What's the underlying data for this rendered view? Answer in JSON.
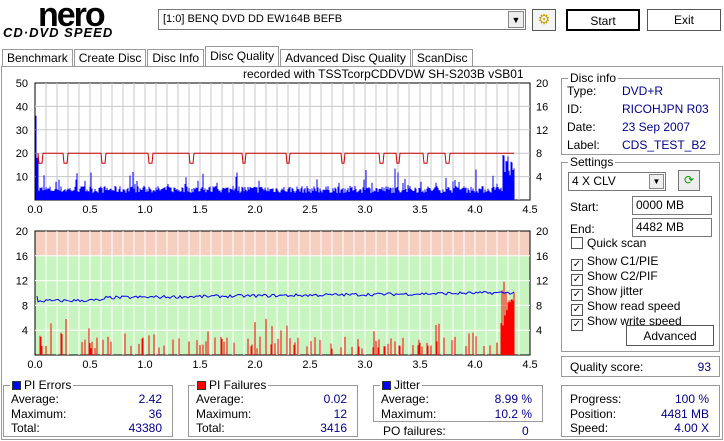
{
  "app": {
    "logo_top": "nero",
    "logo_bottom": "CD·DVD SPEED"
  },
  "toolbar": {
    "drive": "[1:0]  BENQ DVD DD EW164B BEFB",
    "start": "Start",
    "exit": "Exit"
  },
  "tabs": [
    "Benchmark",
    "Create Disc",
    "Disc Info",
    "Disc Quality",
    "Advanced Disc Quality",
    "ScanDisc"
  ],
  "recorded_with": "recorded with TSSTcorpCDDVDW SH-S203B  vSB01",
  "disc_info": {
    "title": "Disc info",
    "type_label": "Type:",
    "type": "DVD+R",
    "id_label": "ID:",
    "id": "RICOHJPN R03",
    "date_label": "Date:",
    "date": "23 Sep 2007",
    "label_label": "Label:",
    "label": "CDS_TEST_B2"
  },
  "settings": {
    "title": "Settings",
    "speed": "4 X CLV",
    "start_label": "Start:",
    "start": "0000 MB",
    "end_label": "End:",
    "end": "4482 MB",
    "quick_scan": "Quick scan",
    "show_c1": "Show C1/PIE",
    "show_c2": "Show C2/PIF",
    "show_jitter": "Show jitter",
    "show_read": "Show read speed",
    "show_write": "Show write speed",
    "advanced": "Advanced",
    "checks": [
      false,
      true,
      true,
      true,
      true,
      true
    ]
  },
  "quality": {
    "label": "Quality score:",
    "value": "93"
  },
  "pi_errors": {
    "title": "PI Errors",
    "avg_label": "Average:",
    "avg": "2.42",
    "max_label": "Maximum:",
    "max": "36",
    "total_label": "Total:",
    "total": "43380",
    "color": "#0000ff"
  },
  "pi_failures": {
    "title": "PI Failures",
    "avg_label": "Average:",
    "avg": "0.02",
    "max_label": "Maximum:",
    "max": "12",
    "total_label": "Total:",
    "total": "3416",
    "color": "#ff0000"
  },
  "jitter": {
    "title": "Jitter",
    "avg_label": "Average:",
    "avg": "8.99 %",
    "max_label": "Maximum:",
    "max": "10.2 %",
    "po_label": "PO failures:",
    "po": "0",
    "color": "#0000ff"
  },
  "progress": {
    "progress_label": "Progress:",
    "progress": "100 %",
    "position_label": "Position:",
    "position": "4481 MB",
    "speed_label": "Speed:",
    "speed": "4.00 X"
  },
  "chart_data": [
    {
      "type": "bar",
      "title": "PI Errors",
      "x_ticks": [
        "0.0",
        "0.5",
        "1.0",
        "1.5",
        "2.0",
        "2.5",
        "3.0",
        "3.5",
        "4.0",
        "4.5"
      ],
      "y_left_ticks": [
        "50",
        "40",
        "30",
        "20",
        "10"
      ],
      "y_right_ticks": [
        "20",
        "16",
        "12",
        "8",
        "4"
      ],
      "xlim": [
        0,
        4.5
      ],
      "ylim": [
        0,
        50
      ],
      "y2lim": [
        0,
        20
      ],
      "pi_typical": 3,
      "pi_max": 36,
      "read_speed": 8,
      "speed_dips_at": [
        0.05,
        0.28,
        0.62,
        1.05,
        1.42,
        1.9,
        2.3,
        2.8,
        3.15,
        3.3,
        3.55,
        3.75
      ]
    },
    {
      "type": "bar",
      "title": "PI Failures / Jitter",
      "x_ticks": [
        "0.0",
        "0.5",
        "1.0",
        "1.5",
        "2.0",
        "2.5",
        "3.0",
        "3.5",
        "4.0",
        "4.5"
      ],
      "y_left_ticks": [
        "20",
        "16",
        "12",
        "8",
        "4"
      ],
      "y_right_ticks": [
        "20",
        "16",
        "12",
        "8",
        "4"
      ],
      "xlim": [
        0,
        4.5
      ],
      "ylim": [
        0,
        20
      ],
      "jitter_avg": 8.99,
      "jitter_max": 10.2,
      "pif_max": 12
    }
  ]
}
